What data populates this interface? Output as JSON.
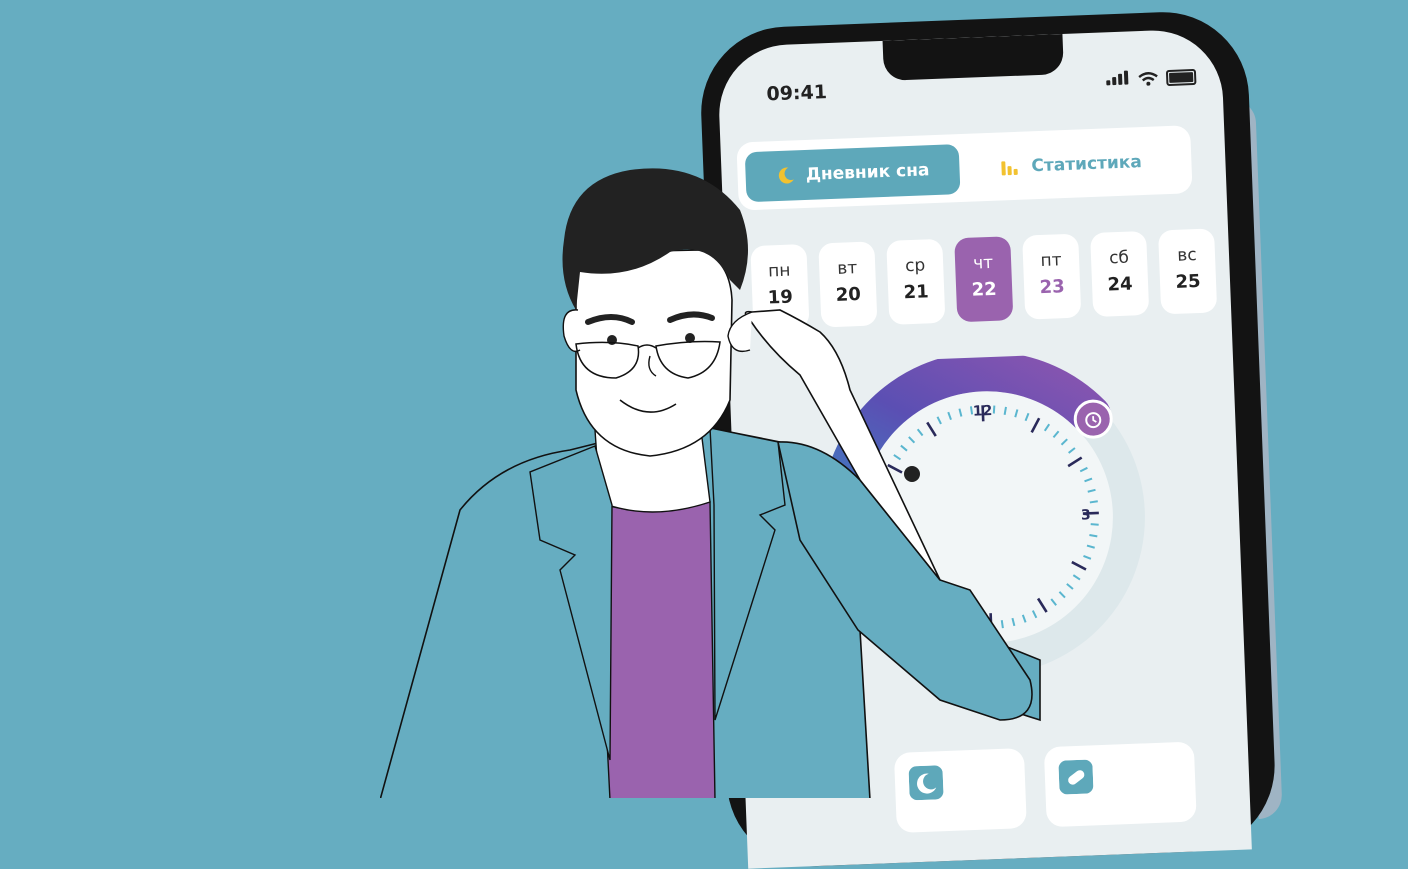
{
  "status_bar": {
    "time": "09:41"
  },
  "tabs": {
    "diary_label": "Дневник сна",
    "stats_label": "Статистика",
    "active": "diary"
  },
  "week": [
    {
      "day": "пн",
      "date": "19"
    },
    {
      "day": "вт",
      "date": "20"
    },
    {
      "day": "ср",
      "date": "21"
    },
    {
      "day": "чт",
      "date": "22",
      "selected": true
    },
    {
      "day": "пт",
      "date": "23",
      "next": true
    },
    {
      "day": "сб",
      "date": "24"
    },
    {
      "day": "вс",
      "date": "25"
    }
  ],
  "dial": {
    "label_12": "12",
    "label_3": "3"
  },
  "icons": [
    "moon-icon",
    "bar-chart-icon",
    "alarm-icon",
    "bed-icon",
    "pill-icon",
    "signal-icon",
    "wifi-icon",
    "battery-icon"
  ],
  "colors": {
    "background": "#66adc1",
    "accent": "#5ea8ba",
    "purple": "#9a63ae",
    "yellow": "#f2c230"
  }
}
